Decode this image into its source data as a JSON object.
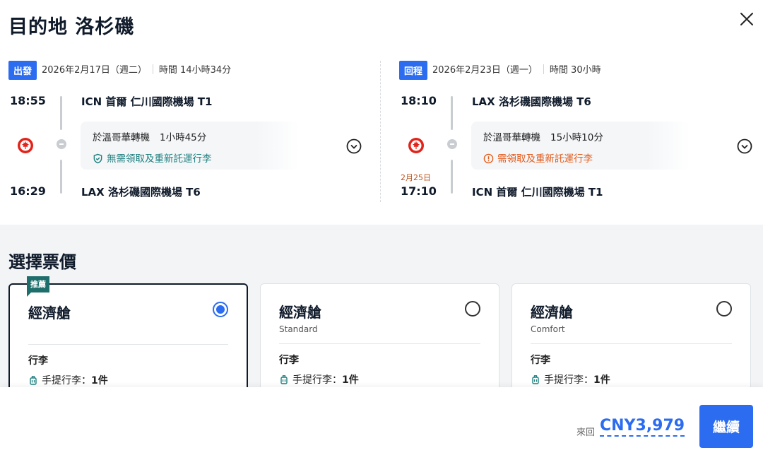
{
  "title": "目的地 洛杉磯",
  "outbound": {
    "tag": "出發",
    "date": "2026年2月17日（週二）",
    "duration": "時間 14小時34分",
    "dep_time": "18:55",
    "dep_airport": "ICN 首爾 仁川國際機場 T1",
    "transfer_city": "於溫哥華轉機",
    "transfer_duration": "1小時45分",
    "baggage_note": "無需領取及重新託運行李",
    "arr_time": "16:29",
    "arr_airport": "LAX 洛杉磯國際機場 T6"
  },
  "return": {
    "tag": "回程",
    "date": "2026年2月23日（週一）",
    "duration": "時間 30小時",
    "dep_time": "18:10",
    "dep_airport": "LAX 洛杉磯國際機場 T6",
    "transfer_city": "於溫哥華轉機",
    "transfer_duration": "15小時10分",
    "baggage_note": "需領取及重新託運行李",
    "arr_date_note": "2月25日",
    "arr_time": "17:10",
    "arr_airport": "ICN 首爾 仁川國際機場 T1"
  },
  "fares": {
    "title": "選擇票價",
    "badge": "推薦",
    "cards": [
      {
        "name": "經濟艙",
        "sub": "",
        "lug_header": "行李",
        "lug_label": "手提行李：",
        "lug_value": "1件"
      },
      {
        "name": "經濟艙",
        "sub": "Standard",
        "lug_header": "行李",
        "lug_label": "手提行李：",
        "lug_value": "1件"
      },
      {
        "name": "經濟艙",
        "sub": "Comfort",
        "lug_header": "行李",
        "lug_label": "手提行李：",
        "lug_value": "1件"
      }
    ]
  },
  "footer": {
    "price_label": "來回",
    "price": "CNY3,979",
    "continue_label": "繼續"
  },
  "colors": {
    "accent": "#2b6cf0",
    "ok": "#1e7f7f",
    "warn": "#e35b1a",
    "badge": "#1e6e6c"
  }
}
